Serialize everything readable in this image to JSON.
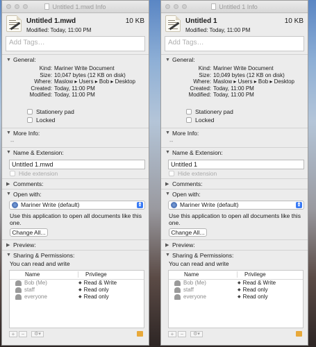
{
  "windows": [
    {
      "title": "Untitled 1.mwd Info",
      "name": "Untitled 1.mwd",
      "size": "10 KB",
      "modified": "Modified: Today, 11:00 PM",
      "tags_placeholder": "Add Tags…",
      "general": {
        "header": "General:",
        "rows": [
          {
            "k": "Kind:",
            "v": "Mariner Write Document"
          },
          {
            "k": "Size:",
            "v": "10,047 bytes (12 KB on disk)"
          },
          {
            "k": "Where:",
            "v": "Maslow ▸ Users ▸ Bob ▸ Desktop"
          },
          {
            "k": "Created:",
            "v": "Today, 11:00 PM"
          },
          {
            "k": "Modified:",
            "v": "Today, 11:00 PM"
          }
        ],
        "stationery": "Stationery pad",
        "locked": "Locked"
      },
      "more_info": {
        "header": "More Info:",
        "value": "--"
      },
      "name_ext": {
        "header": "Name & Extension:",
        "value": "Untitled 1.mwd",
        "hide": "Hide extension"
      },
      "comments": "Comments:",
      "open_with": {
        "header": "Open with:",
        "app": "Mariner Write (default)",
        "desc": "Use this application to open all documents like this one.",
        "button": "Change All..."
      },
      "preview": "Preview:",
      "sharing": {
        "header": "Sharing & Permissions:",
        "status": "You can read and write",
        "col_name": "Name",
        "col_priv": "Privilege",
        "rows": [
          {
            "name": "Bob (Me)",
            "priv": "Read & Write"
          },
          {
            "name": "staff",
            "priv": "Read only"
          },
          {
            "name": "everyone",
            "priv": "Read only"
          }
        ]
      }
    },
    {
      "title": "Untitled 1 Info",
      "name": "Untitled 1",
      "size": "10 KB",
      "modified": "Modified: Today, 11:00 PM",
      "tags_placeholder": "Add Tags…",
      "general": {
        "header": "General:",
        "rows": [
          {
            "k": "Kind:",
            "v": "Mariner Write Document"
          },
          {
            "k": "Size:",
            "v": "10,049 bytes (12 KB on disk)"
          },
          {
            "k": "Where:",
            "v": "Maslow ▸ Users ▸ Bob ▸ Desktop"
          },
          {
            "k": "Created:",
            "v": "Today, 11:00 PM"
          },
          {
            "k": "Modified:",
            "v": "Today, 11:00 PM"
          }
        ],
        "stationery": "Stationery pad",
        "locked": "Locked"
      },
      "more_info": {
        "header": "More Info:",
        "value": "--"
      },
      "name_ext": {
        "header": "Name & Extension:",
        "value": "Untitled 1",
        "hide": "Hide extension"
      },
      "comments": "Comments:",
      "open_with": {
        "header": "Open with:",
        "app": "Mariner Write (default)",
        "desc": "Use this application to open all documents like this one.",
        "button": "Change All..."
      },
      "preview": "Preview:",
      "sharing": {
        "header": "Sharing & Permissions:",
        "status": "You can read and write",
        "col_name": "Name",
        "col_priv": "Privilege",
        "rows": [
          {
            "name": "Bob (Me)",
            "priv": "Read & Write"
          },
          {
            "name": "staff",
            "priv": "Read only"
          },
          {
            "name": "everyone",
            "priv": "Read only"
          }
        ]
      }
    }
  ]
}
